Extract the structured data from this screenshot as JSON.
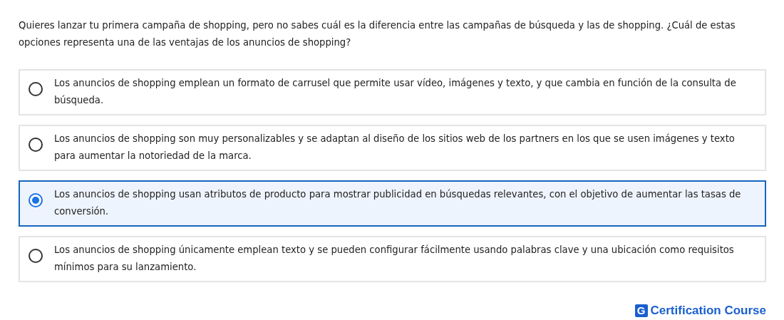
{
  "question": "Quieres lanzar tu primera campaña de shopping, pero no sabes cuál es la diferencia entre las campañas de búsqueda y las de shopping. ¿Cuál de estas opciones representa una de las ventajas de los anuncios de shopping?",
  "options": [
    {
      "text": "Los anuncios de shopping emplean un formato de carrusel que permite usar vídeo, imágenes y texto, y que cambia en función de la consulta de búsqueda.",
      "selected": false
    },
    {
      "text": "Los anuncios de shopping son muy personalizables y se adaptan al diseño de los sitios web de los partners en los que se usen imágenes y texto para aumentar la notoriedad de la marca.",
      "selected": false
    },
    {
      "text": "Los anuncios de shopping usan atributos de producto para mostrar publicidad en búsquedas relevantes, con el objetivo de aumentar las tasas de conversión.",
      "selected": true
    },
    {
      "text": "Los anuncios de shopping únicamente emplean texto y se pueden configurar fácilmente usando palabras clave y una ubicación como requisitos mínimos para su lanzamiento.",
      "selected": false
    }
  ],
  "brand": {
    "mark": "G",
    "name": "Certification Course"
  }
}
